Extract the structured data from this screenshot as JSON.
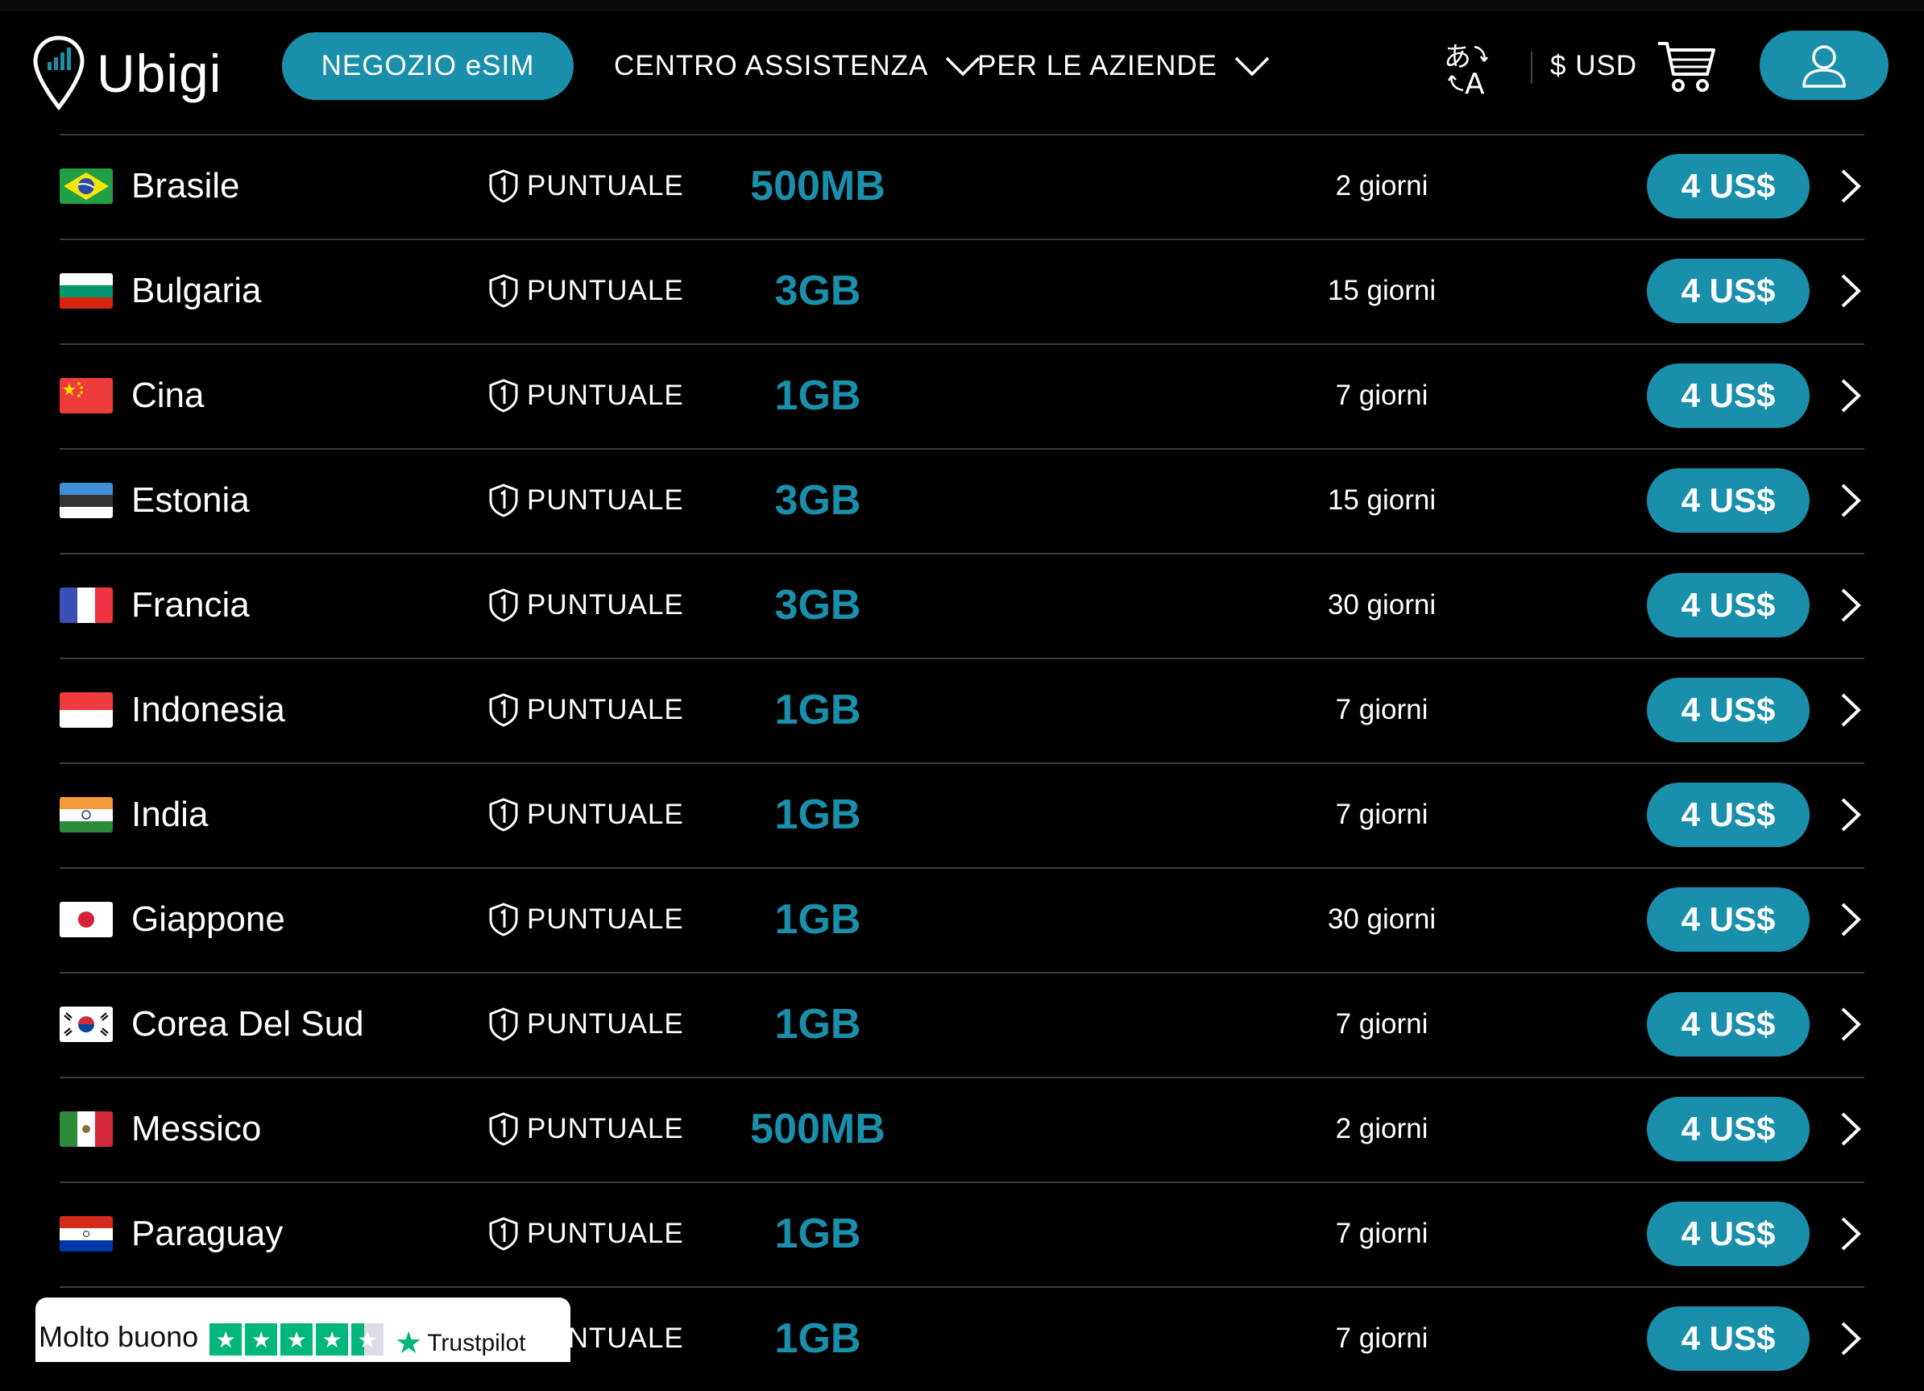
{
  "header": {
    "brand": "Ubigi",
    "nav": {
      "store_label": "NEGOZIO eSIM",
      "support_label": "CENTRO ASSISTENZA",
      "business_label": "PER LE AZIENDE"
    },
    "currency": "$ USD"
  },
  "plans": [
    {
      "country": "Brasile",
      "flag": "brazil-flag",
      "badge": "PUNTUALE",
      "data": "500MB",
      "duration": "2 giorni",
      "price": "4 US$"
    },
    {
      "country": "Bulgaria",
      "flag": "bulgaria-flag",
      "badge": "PUNTUALE",
      "data": "3GB",
      "duration": "15 giorni",
      "price": "4 US$"
    },
    {
      "country": "Cina",
      "flag": "china-flag",
      "badge": "PUNTUALE",
      "data": "1GB",
      "duration": "7 giorni",
      "price": "4 US$"
    },
    {
      "country": "Estonia",
      "flag": "estonia-flag",
      "badge": "PUNTUALE",
      "data": "3GB",
      "duration": "15 giorni",
      "price": "4 US$"
    },
    {
      "country": "Francia",
      "flag": "france-flag",
      "badge": "PUNTUALE",
      "data": "3GB",
      "duration": "30 giorni",
      "price": "4 US$"
    },
    {
      "country": "Indonesia",
      "flag": "indonesia-flag",
      "badge": "PUNTUALE",
      "data": "1GB",
      "duration": "7 giorni",
      "price": "4 US$"
    },
    {
      "country": "India",
      "flag": "india-flag",
      "badge": "PUNTUALE",
      "data": "1GB",
      "duration": "7 giorni",
      "price": "4 US$"
    },
    {
      "country": "Giappone",
      "flag": "japan-flag",
      "badge": "PUNTUALE",
      "data": "1GB",
      "duration": "30 giorni",
      "price": "4 US$"
    },
    {
      "country": "Corea Del Sud",
      "flag": "south-korea-flag",
      "badge": "PUNTUALE",
      "data": "1GB",
      "duration": "7 giorni",
      "price": "4 US$"
    },
    {
      "country": "Messico",
      "flag": "mexico-flag",
      "badge": "PUNTUALE",
      "data": "500MB",
      "duration": "2 giorni",
      "price": "4 US$"
    },
    {
      "country": "Paraguay",
      "flag": "paraguay-flag",
      "badge": "PUNTUALE",
      "data": "1GB",
      "duration": "7 giorni",
      "price": "4 US$"
    },
    {
      "country": "",
      "flag": "",
      "badge": "PUNTUALE",
      "data": "1GB",
      "duration": "7 giorni",
      "price": "4 US$"
    }
  ],
  "review_widget": {
    "rating_text": "Molto buono",
    "brand": "Trustpilot",
    "stars": 4.5
  },
  "colors": {
    "accent": "#1a8fab",
    "background": "#000000",
    "text": "#ffffff",
    "divider": "#3a3a3a",
    "trustpilot_green": "#00b67a"
  }
}
